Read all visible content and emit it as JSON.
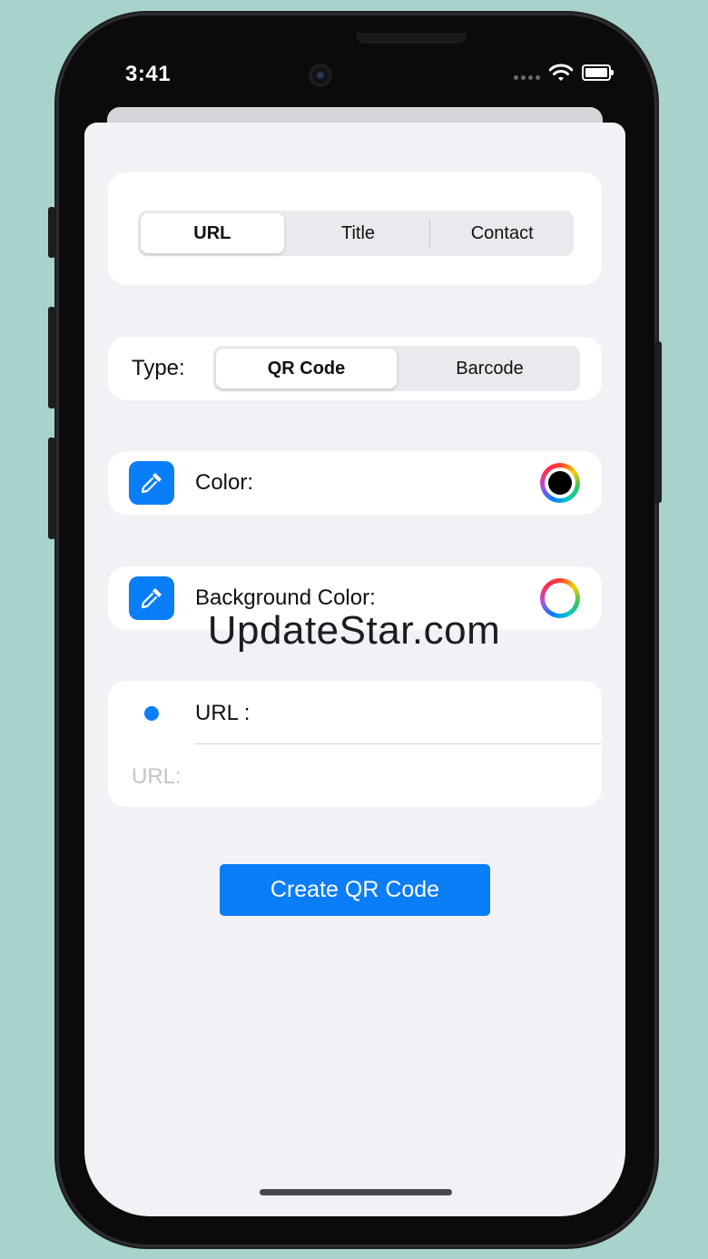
{
  "status_bar": {
    "time": "3:41"
  },
  "segment_top": {
    "items": [
      "URL",
      "Title",
      "Contact"
    ],
    "selected": "URL"
  },
  "type_row": {
    "label": "Type:",
    "options": [
      "QR Code",
      "Barcode"
    ],
    "selected": "QR Code"
  },
  "color_row": {
    "label": "Color:",
    "value_color": "#000000",
    "icon": "eyedropper-icon"
  },
  "bg_color_row": {
    "label": "Background Color:",
    "value_color": "#ffffff",
    "icon": "eyedropper-icon"
  },
  "url_section": {
    "header": "URL :",
    "field_placeholder": "URL:",
    "field_value": ""
  },
  "primary_button": {
    "label": "Create QR Code"
  },
  "watermark": "UpdateStar.com",
  "colors": {
    "accent": "#0a7df8",
    "background": "#a8d3cd",
    "sheet": "#f1f1f6"
  }
}
